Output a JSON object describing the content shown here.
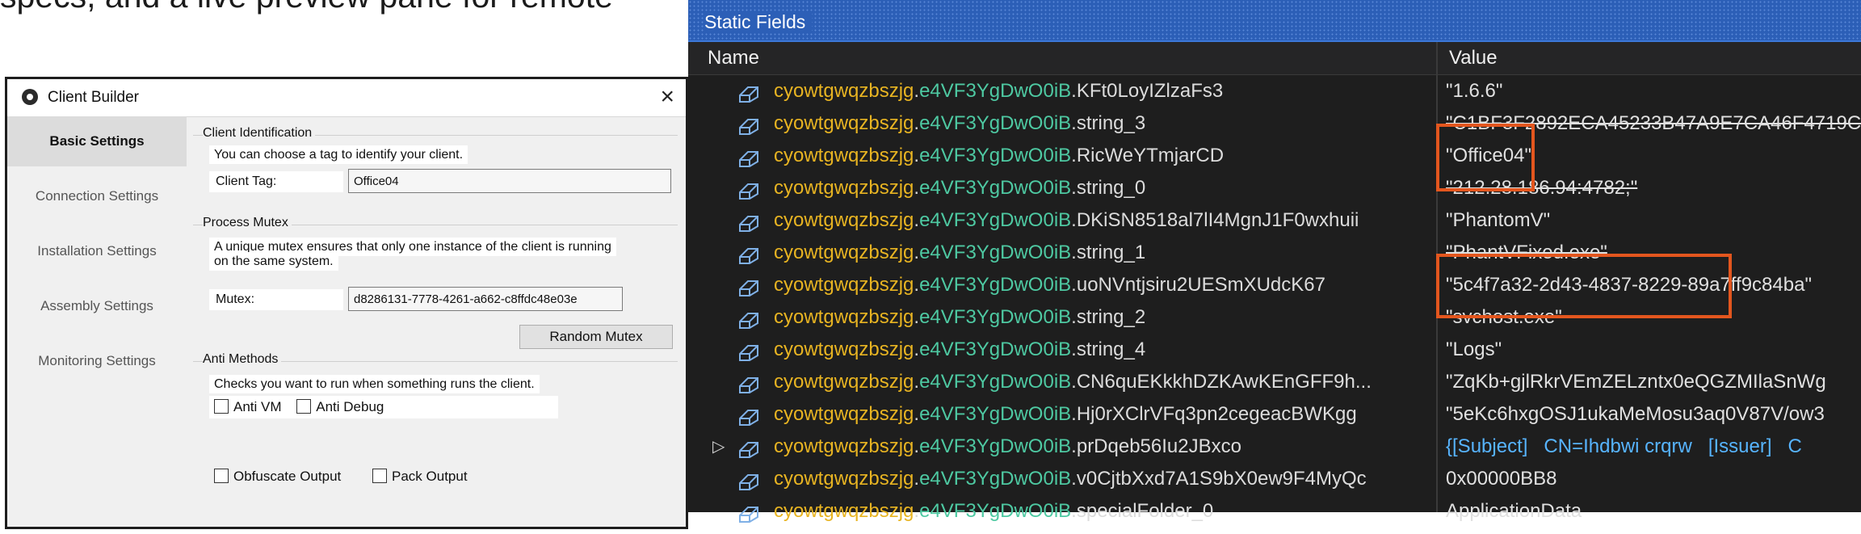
{
  "caption": "specs, and a live preview pane for remote",
  "client_builder": {
    "title": "Client Builder",
    "close": "×",
    "nav": [
      {
        "label": "Basic Settings",
        "active": true
      },
      {
        "label": "Connection Settings"
      },
      {
        "label": "Installation Settings"
      },
      {
        "label": "Assembly Settings"
      },
      {
        "label": "Monitoring Settings"
      }
    ],
    "client_identification": {
      "title": "Client Identification",
      "description": "You can choose a tag to identify your client.",
      "tag_label": "Client Tag:",
      "tag_value": "Office04"
    },
    "process_mutex": {
      "title": "Process Mutex",
      "description_1": "A unique mutex ensures that only one instance of the client is running",
      "description_2": "on the same system.",
      "mutex_label": "Mutex:",
      "mutex_value": "d8286131-7778-4261-a662-c8ffdc48e03e",
      "random_button": "Random Mutex"
    },
    "anti_methods": {
      "title": "Anti Methods",
      "description": "Checks you want to run when something runs the client.",
      "anti_vm": "Anti VM",
      "anti_debug": "Anti Debug"
    },
    "output": {
      "obfuscate": "Obfuscate Output",
      "pack": "Pack Output"
    }
  },
  "static_fields": {
    "title": "Static Fields",
    "col_name": "Name",
    "col_value": "Value",
    "colors": {
      "namespace": "#e8b422",
      "class": "#4ec9a2",
      "highlight": "#e3561e"
    },
    "rows": [
      {
        "ns": "cyowtgwqzbszjg",
        "cls": "e4VF3YgDwO0iB",
        "member": "KFt0LoyIZlzaFs3",
        "value": "\"1.6.6\""
      },
      {
        "ns": "cyowtgwqzbszjg",
        "cls": "e4VF3YgDwO0iB",
        "member": "string_3",
        "value": "\"C1BF3F2892ECA45233B47A9E7CA46F4719C"
      },
      {
        "ns": "cyowtgwqzbszjg",
        "cls": "e4VF3YgDwO0iB",
        "member": "RicWeYTmjarCD",
        "value": "\"Office04\""
      },
      {
        "ns": "cyowtgwqzbszjg",
        "cls": "e4VF3YgDwO0iB",
        "member": "string_0",
        "value": "\"212.28.186.94:4782;\""
      },
      {
        "ns": "cyowtgwqzbszjg",
        "cls": "e4VF3YgDwO0iB",
        "member": "DKiSN8518al7lI4MgnJ1F0wxhuii",
        "value": "\"PhantomV\""
      },
      {
        "ns": "cyowtgwqzbszjg",
        "cls": "e4VF3YgDwO0iB",
        "member": "string_1",
        "value": "\"PhantVFixed.exe\""
      },
      {
        "ns": "cyowtgwqzbszjg",
        "cls": "e4VF3YgDwO0iB",
        "member": "uoNVntjsiru2UESmXUdcK67",
        "value": "\"5c4f7a32-2d43-4837-8229-89a7ff9c84ba\""
      },
      {
        "ns": "cyowtgwqzbszjg",
        "cls": "e4VF3YgDwO0iB",
        "member": "string_2",
        "value": "\"svchost.exe\""
      },
      {
        "ns": "cyowtgwqzbszjg",
        "cls": "e4VF3YgDwO0iB",
        "member": "string_4",
        "value": "\"Logs\""
      },
      {
        "ns": "cyowtgwqzbszjg",
        "cls": "e4VF3YgDwO0iB",
        "member": "CN6quEKkkhDZKAwKEnGFF9h...",
        "value": "\"ZqKb+gjlRkrVEmZELzntx0eQGZMIlaSnWg"
      },
      {
        "ns": "cyowtgwqzbszjg",
        "cls": "e4VF3YgDwO0iB",
        "member": "Hj0rXClrVFq3pn2cegeacBWKgg",
        "value": "\"5eKc6hxgOSJ1ukaMeMosu3aq0V87V/ow3"
      },
      {
        "ns": "cyowtgwqzbszjg",
        "cls": "e4VF3YgDwO0iB",
        "member": "prDqeb56Iu2JBxco",
        "value_subject": "{[Subject]",
        "value_cn": "CN=Ihdbwi crqrw",
        "value_issuer": "[Issuer]",
        "value_c": "C"
      },
      {
        "ns": "cyowtgwqzbszjg",
        "cls": "e4VF3YgDwO0iB",
        "member": "v0CjtbXxd7A1S9bX0ew9F4MyQc",
        "value": "0x00000BB8"
      },
      {
        "ns": "cyowtgwqzbszjg",
        "cls": "e4VF3YgDwO0iB",
        "member": "specialFolder_0",
        "value": "ApplicationData"
      }
    ]
  }
}
